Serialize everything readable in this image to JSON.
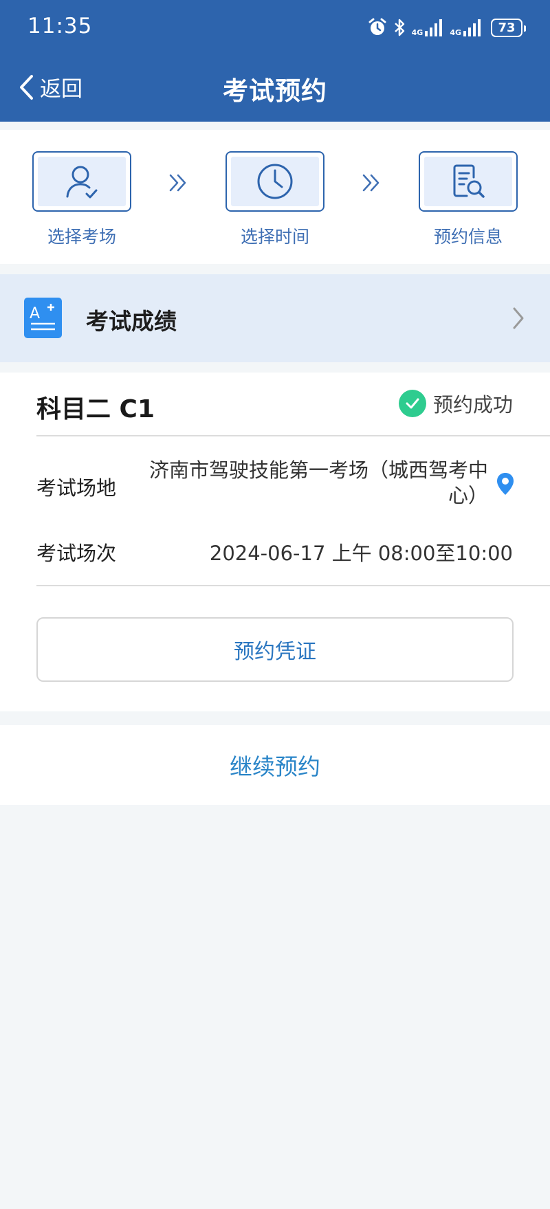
{
  "status_bar": {
    "time": "11:35",
    "network_1": "4G",
    "network_2": "4G",
    "battery": "73"
  },
  "header": {
    "back_label": "返回",
    "title": "考试预约"
  },
  "steps": [
    {
      "label": "选择考场",
      "icon": "person-check-icon"
    },
    {
      "label": "选择时间",
      "icon": "clock-icon"
    },
    {
      "label": "预约信息",
      "icon": "document-search-icon"
    }
  ],
  "score": {
    "label": "考试成绩",
    "icon": "grade-icon"
  },
  "appointment": {
    "subject": "科目二 C1",
    "status": "预约成功",
    "venue_label": "考试场地",
    "venue_value": "济南市驾驶技能第一考场（城西驾考中心）",
    "session_label": "考试场次",
    "session_value": "2024-06-17 上午 08:00至10:00",
    "voucher_button": "预约凭证"
  },
  "continue_button": "继续预约",
  "colors": {
    "header_bg": "#2d64ad",
    "accent": "#2a85c8",
    "success": "#2ecc8f",
    "score_bg": "#e3ecf8",
    "page_bg": "#f3f6f8"
  }
}
